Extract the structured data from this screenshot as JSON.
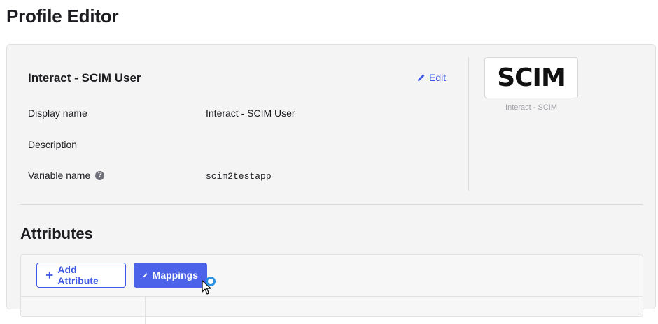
{
  "page": {
    "title": "Profile Editor"
  },
  "profile": {
    "name": "Interact - SCIM User",
    "edit_label": "Edit",
    "rows": [
      {
        "label": "Display name",
        "value": "Interact - SCIM User"
      },
      {
        "label": "Description",
        "value": ""
      },
      {
        "label": "Variable name",
        "value": "scim2testapp",
        "help_icon": "question-icon"
      }
    ]
  },
  "app_logo": {
    "text": "SCIM",
    "caption": "Interact - SCIM"
  },
  "attributes": {
    "title": "Attributes",
    "add_attribute_label": "Add Attribute",
    "mappings_label": "Mappings"
  },
  "colors": {
    "accent": "#3f59e4",
    "primary_button": "#4c62e8",
    "panel_background": "#f4f4f4"
  },
  "icons": {
    "edit": "pencil-icon",
    "add": "plus-icon",
    "mappings": "pencil-icon",
    "help": "question-icon",
    "cursor": "pointer-cursor-icon",
    "busy": "loading-spinner-icon"
  }
}
